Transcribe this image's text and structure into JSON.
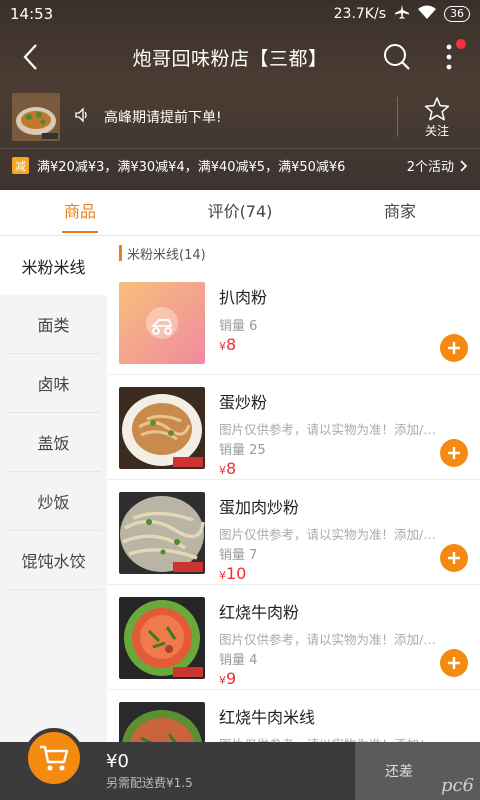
{
  "status": {
    "time": "14:53",
    "network": "23.7K/s",
    "battery": "36"
  },
  "shop": {
    "title": "炮哥回味粉店【三都】",
    "notice": "高峰期请提前下单!",
    "follow_label": "关注",
    "promo_badge": "减",
    "promo_text": "满¥20减¥3，满¥30减¥4，满¥40减¥5，满¥50减¥6",
    "promo_more": "2个活动"
  },
  "tabs": [
    {
      "label": "商品",
      "active": true
    },
    {
      "label": "评价(74)",
      "active": false
    },
    {
      "label": "商家",
      "active": false
    }
  ],
  "sidebar": {
    "items": [
      {
        "label": "米粉米线",
        "active": true
      },
      {
        "label": "面类"
      },
      {
        "label": "卤味"
      },
      {
        "label": "盖饭"
      },
      {
        "label": "炒饭"
      },
      {
        "label": "馄饨水饺"
      }
    ]
  },
  "section": {
    "title": "米粉米线(14)"
  },
  "products": [
    {
      "name": "扒肉粉",
      "desc": "",
      "sales": "销量 6",
      "currency": "¥",
      "price": "8",
      "image": "placeholder"
    },
    {
      "name": "蛋炒粉",
      "desc": "图片仅供参考，请以实物为准！添加/减...",
      "sales": "销量 25",
      "currency": "¥",
      "price": "8",
      "image": "fried-noodles"
    },
    {
      "name": "蛋加肉炒粉",
      "desc": "图片仅供参考，请以实物为准！添加/减...",
      "sales": "销量 7",
      "currency": "¥",
      "price": "10",
      "image": "fried-noodles-meat"
    },
    {
      "name": "红烧牛肉粉",
      "desc": "图片仅供参考，请以实物为准！添加/减...",
      "sales": "销量 4",
      "currency": "¥",
      "price": "9",
      "image": "beef-noodle-soup"
    },
    {
      "name": "红烧牛肉米线",
      "desc": "图片仅供参考，请以实物为准！添加/减...",
      "sales": "",
      "currency": "",
      "price": "",
      "image": "beef-rice-noodle"
    }
  ],
  "cart": {
    "total": "¥0",
    "delivery_note": "另需配送费¥1.5",
    "checkout_label": "还差",
    "watermark": "pc6"
  },
  "colors": {
    "accent": "#f07d14",
    "price": "#f23030",
    "add_button": "#f58a10"
  }
}
